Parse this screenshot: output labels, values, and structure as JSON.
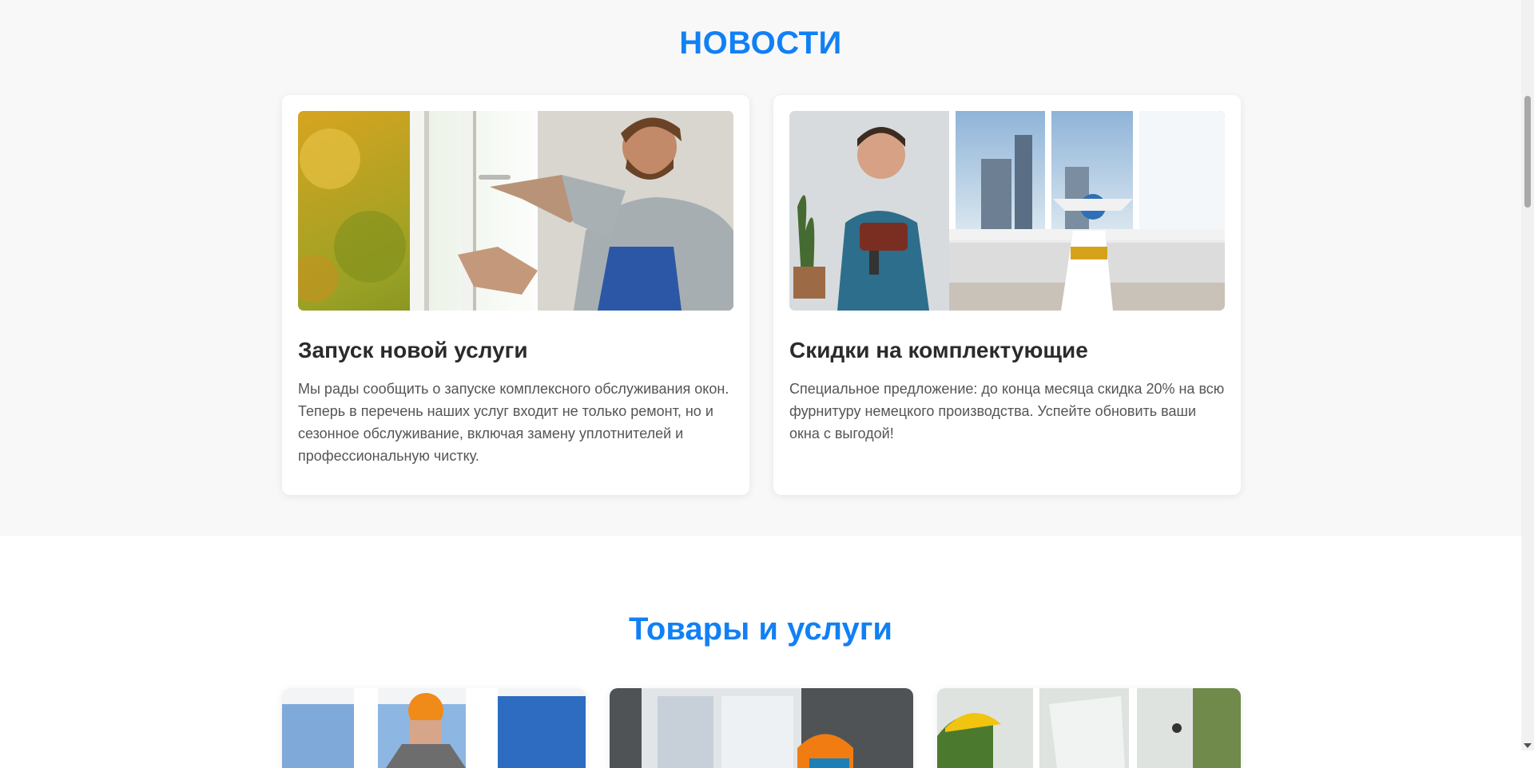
{
  "news": {
    "title": "НОВОСТИ",
    "cards": [
      {
        "title": "Запуск новой услуги",
        "text": "Мы рады сообщить о запуске комплексного обслуживания окон. Теперь в перечень наших услуг входит не только ремонт, но и сезонное обслуживание, включая замену уплотнителей и профессиональную чистку."
      },
      {
        "title": "Скидки на комплектующие",
        "text": "Специальное предложение: до конца месяца скидка 20% на всю фурнитуру немецкого производства. Успейте обновить ваши окна с выгодой!"
      }
    ]
  },
  "products": {
    "title": "Товары и услуги"
  },
  "colors": {
    "accent": "#1180f4",
    "section_bg": "#f8f8f8",
    "card_bg": "#ffffff",
    "heading_text": "#2b2b2b",
    "body_text": "#555555"
  }
}
